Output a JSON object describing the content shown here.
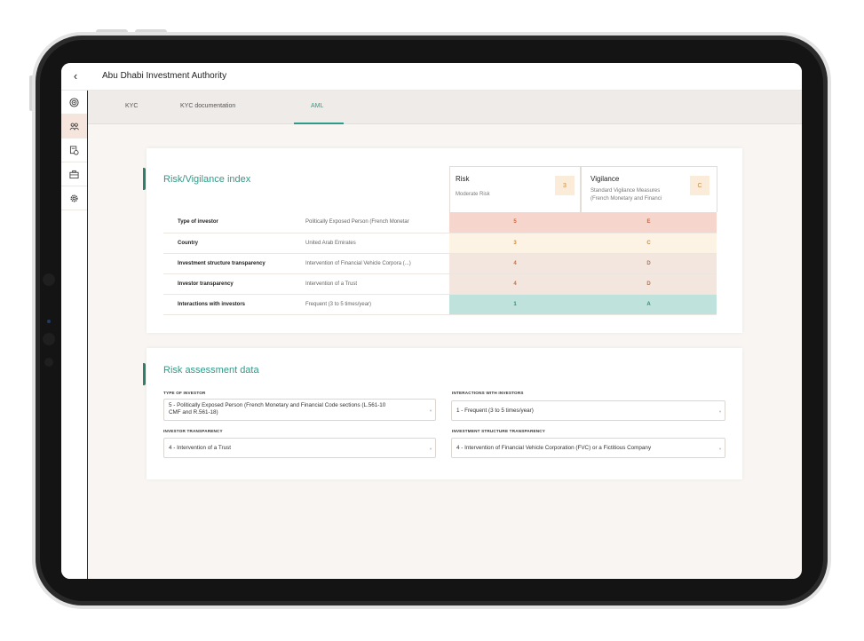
{
  "header": {
    "back_icon": "chevron-left-icon",
    "title": "Abu Dhabi Investment Authority"
  },
  "sidebar": {
    "items": [
      {
        "icon": "globe-icon",
        "active": false
      },
      {
        "icon": "users-icon",
        "active": true
      },
      {
        "icon": "document-stamp-icon",
        "active": false
      },
      {
        "icon": "briefcase-icon",
        "active": false
      },
      {
        "icon": "gear-icon",
        "active": false
      }
    ]
  },
  "tabs": [
    {
      "label": "KYC",
      "active": false
    },
    {
      "label": "KYC documentation",
      "active": false
    },
    {
      "label": "AML",
      "active": true
    }
  ],
  "risk_index": {
    "title": "Risk/Vigilance index",
    "risk": {
      "label": "Risk",
      "sub": "Moderate Risk",
      "badge": "3"
    },
    "vigilance": {
      "label": "Vigilance",
      "sub_line1": "Standard Vigilance Measures",
      "sub_line2": "(French Monetary and Financi",
      "badge": "C"
    },
    "rows": [
      {
        "type": "Type of investor",
        "value": "Politically Exposed Person (French Monetar",
        "risk": "5",
        "vigilance": "E",
        "bg": "#f6d6cc",
        "fg": "#c9653f"
      },
      {
        "type": "Country",
        "value": "United Arab Emirates",
        "risk": "3",
        "vigilance": "C",
        "bg": "#fdf3e5",
        "fg": "#cf8a3b"
      },
      {
        "type": "Investment structure transparency",
        "value": "Intervention of Financial Vehicle Corpora (...)",
        "risk": "4",
        "vigilance": "D",
        "bg": "#f3e6df",
        "fg": "#b9734f"
      },
      {
        "type": "Investor transparency",
        "value": "Intervention of a Trust",
        "risk": "4",
        "vigilance": "D",
        "bg": "#f3e6df",
        "fg": "#b9734f"
      },
      {
        "type": "Interactions with investors",
        "value": "Frequent (3 to 5 times/year)",
        "risk": "1",
        "vigilance": "A",
        "bg": "#bfe3dc",
        "fg": "#2f8a78"
      }
    ]
  },
  "assessment": {
    "title": "Risk assessment data",
    "fields": {
      "type_of_investor": {
        "label": "TYPE OF INVESTOR",
        "line1": "5 - Politically Exposed Person (French Monetary and Financial Code sections (L.561-10",
        "line2": "CMF and R.561-18)"
      },
      "interactions": {
        "label": "INTERACTIONS WITH INVESTORS",
        "value": "1 - Frequent (3 to 5 times/year)"
      },
      "investor_transparency": {
        "label": "INVESTOR TRANSPARENCY",
        "value": "4 - Intervention of a Trust"
      },
      "structure_transparency": {
        "label": "INVESTMENT STRUCTURE TRANSPARENCY",
        "value": "4 - Intervention of Financial Vehicle Corporation (FVC) or a Fictitious Company"
      }
    }
  },
  "colors": {
    "accent": "#2f9a87",
    "accent_dark": "#2f7f6f",
    "background": "#f8f5f2"
  }
}
